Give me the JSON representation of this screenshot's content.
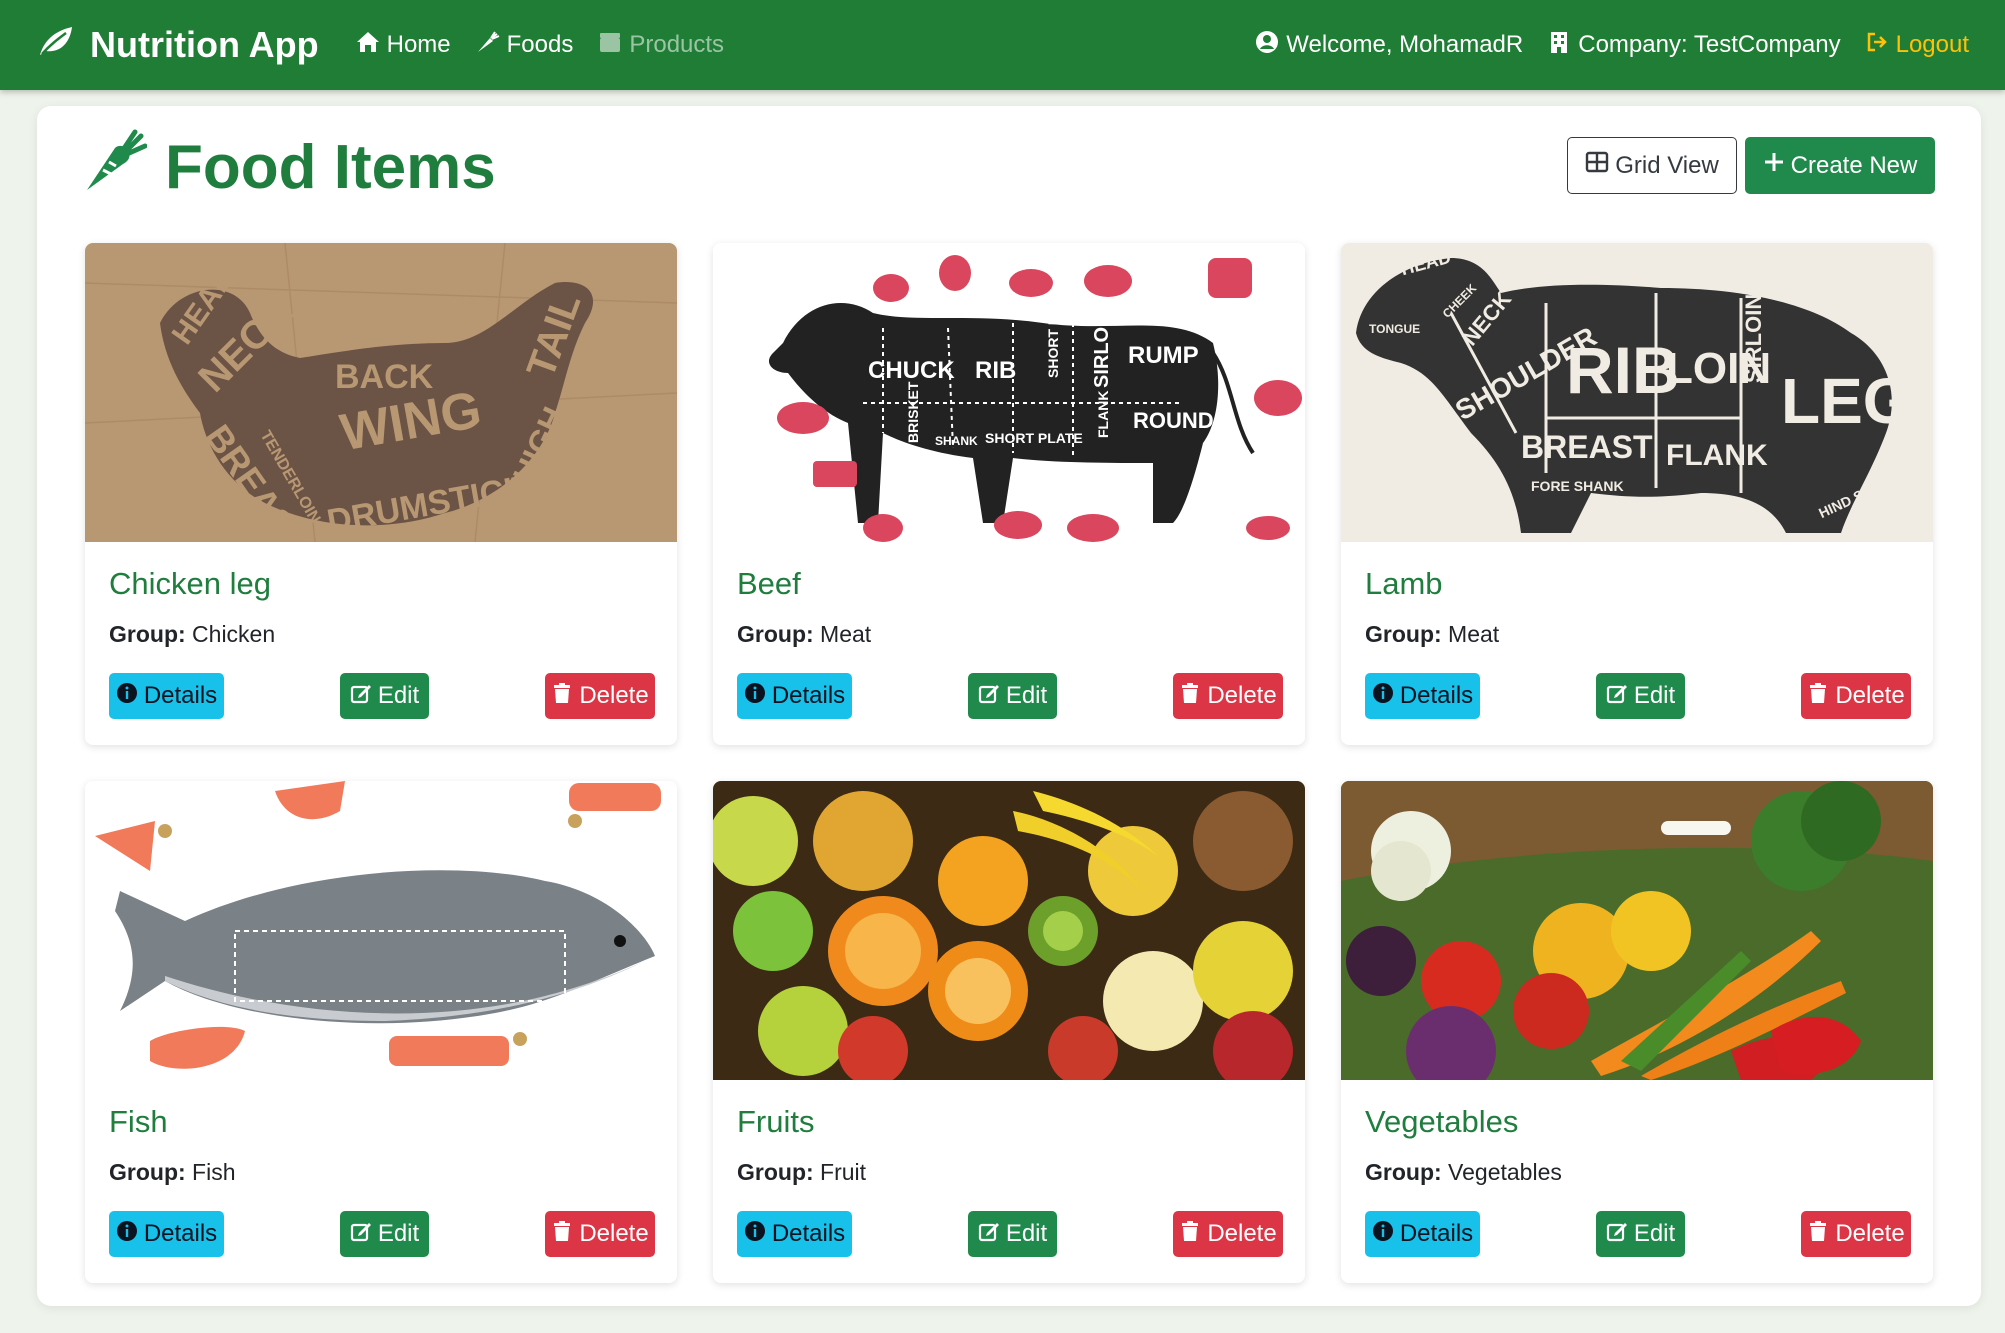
{
  "navbar": {
    "brand": "Nutrition App",
    "links": [
      {
        "label": "Home",
        "icon": "home-icon"
      },
      {
        "label": "Foods",
        "icon": "carrot-icon"
      },
      {
        "label": "Products",
        "icon": "box-icon"
      }
    ],
    "welcome": "Welcome, MohamadR",
    "company": "Company: TestCompany",
    "logout": "Logout"
  },
  "page": {
    "title": "Food Items",
    "grid_view_label": "Grid View",
    "create_new_label": "Create New"
  },
  "labels": {
    "group": "Group:",
    "details": "Details",
    "edit": "Edit",
    "delete": "Delete"
  },
  "items": [
    {
      "name": "Chicken leg",
      "group": "Chicken",
      "image": "chicken-cuts-chart"
    },
    {
      "name": "Beef",
      "group": "Meat",
      "image": "beef-cuts-chart"
    },
    {
      "name": "Lamb",
      "group": "Meat",
      "image": "lamb-cuts-chart"
    },
    {
      "name": "Fish",
      "group": "Fish",
      "image": "salmon-cuts-chart"
    },
    {
      "name": "Fruits",
      "group": "Fruit",
      "image": "assorted-fruits-photo"
    },
    {
      "name": "Vegetables",
      "group": "Vegetables",
      "image": "vegetables-basket-photo"
    }
  ],
  "image_text": {
    "chicken": [
      "HEAD",
      "NECK",
      "BACK",
      "WING",
      "TAIL",
      "BREAST",
      "DRUMSTICK",
      "THIGH",
      "TENDERLOIN"
    ],
    "beef": [
      "CHUCK",
      "RIB",
      "SHORT LOIN",
      "SIRLOIN",
      "RUMP",
      "ROUND",
      "BRISKET",
      "SHANK",
      "SHORT PLATE",
      "FLANK"
    ],
    "lamb": [
      "HEAD",
      "CHEEK",
      "TONGUE",
      "NECK",
      "SHOULDER",
      "RIB",
      "LOIN",
      "SIRLOIN",
      "LEG",
      "BREAST",
      "FLANK",
      "FORE SHANK",
      "HIND SHANK"
    ]
  },
  "colors": {
    "navbar": "#1f7d35",
    "accent_green": "#1f8a4c",
    "title_green": "#1f7d3e",
    "details": "#17c1ea",
    "delete": "#dc3545",
    "logout": "#ffc107"
  }
}
